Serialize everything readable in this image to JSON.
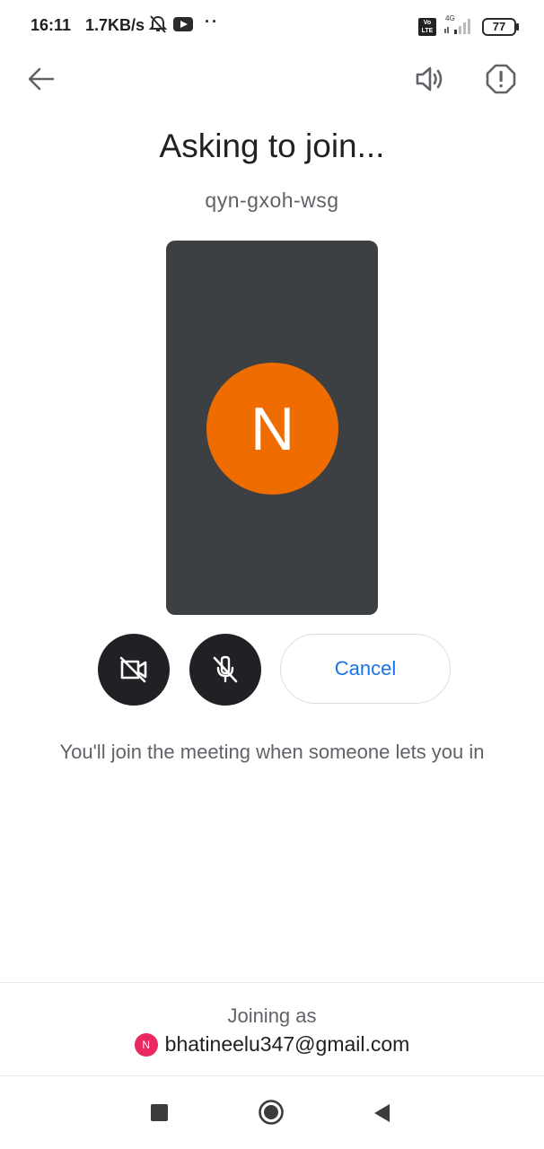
{
  "status_bar": {
    "time": "16:11",
    "speed": "1.7KB/s",
    "dots": "··",
    "volte": "Vo LTE",
    "network": "4G",
    "battery": "77"
  },
  "top_bar": {
    "back_icon": "arrow-left-icon",
    "speaker_icon": "speaker-icon",
    "report_icon": "report-icon"
  },
  "header": {
    "title": "Asking to join...",
    "meeting_code": "qyn-gxoh-wsg"
  },
  "preview": {
    "avatar_initial": "N",
    "avatar_color": "#ee6c00",
    "background": "#3c4043"
  },
  "controls": {
    "camera_icon": "camera-off-icon",
    "mic_icon": "mic-off-icon",
    "cancel_label": "Cancel"
  },
  "info": {
    "message": "You'll join the meeting when someone lets you in"
  },
  "footer": {
    "joining_label": "Joining as",
    "avatar_initial": "N",
    "avatar_color": "#e8285f",
    "email": "bhatineelu347@gmail.com"
  },
  "colors": {
    "accent": "#1a73e8",
    "dark_button": "#202124"
  }
}
